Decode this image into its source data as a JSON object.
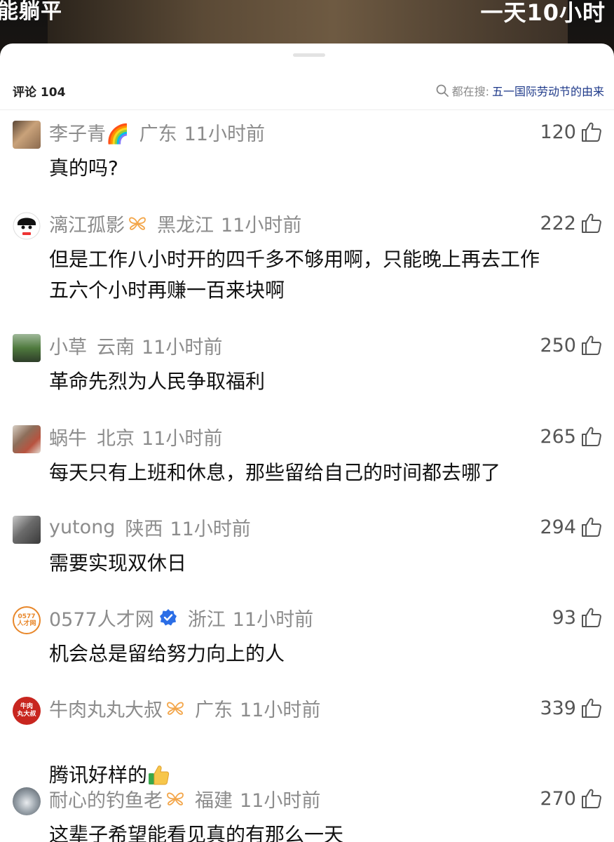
{
  "video": {
    "caption_left": "能躺平",
    "caption_right": "一天10小时"
  },
  "header": {
    "comment_count_label": "评论 104",
    "search_prefix": "都在搜:",
    "search_term": "五一国际劳动节的由来"
  },
  "comments": [
    {
      "author": "李子青🌈",
      "location": "广东",
      "time": "11小时前",
      "likes": "120",
      "text": "真的吗?"
    },
    {
      "author": "漓江孤影",
      "location": "黑龙江",
      "time": "11小时前",
      "likes": "222",
      "text": "但是工作八小时开的四千多不够用啊，只能晚上再去工作\n五六个小时再赚一百来块啊"
    },
    {
      "author": "小草",
      "location": "云南",
      "time": "11小时前",
      "likes": "250",
      "text": "革命先烈为人民争取福利"
    },
    {
      "author": "蜗牛",
      "location": "北京",
      "time": "11小时前",
      "likes": "265",
      "text": "每天只有上班和休息，那些留给自己的时间都去哪了"
    },
    {
      "author": "yutong",
      "location": "陕西",
      "time": "11小时前",
      "likes": "294",
      "text": "需要实现双休日"
    },
    {
      "author": "0577人才网",
      "location": "浙江",
      "time": "11小时前",
      "likes": "93",
      "text": "机会总是留给努力向上的人"
    },
    {
      "author": "牛肉丸丸大叔",
      "location": "广东",
      "time": "11小时前",
      "likes": "339",
      "text": "腾讯好样的"
    },
    {
      "author": "耐心的钓鱼老",
      "location": "福建",
      "time": "11小时前",
      "likes": "270",
      "text": "这辈子希望能看见真的有那么一天"
    }
  ],
  "avatar_texts": {
    "avatar_0577": "0577\n人才网",
    "avatar_beef_top": "牛肉",
    "avatar_beef_bottom": "丸大叔"
  },
  "colors": {
    "meta_gray": "#8c8c8c",
    "body_text": "#111111",
    "search_term_blue": "#1f3a8a",
    "verified_blue": "#2b6ee6",
    "badge_orange": "#f3a64a"
  }
}
